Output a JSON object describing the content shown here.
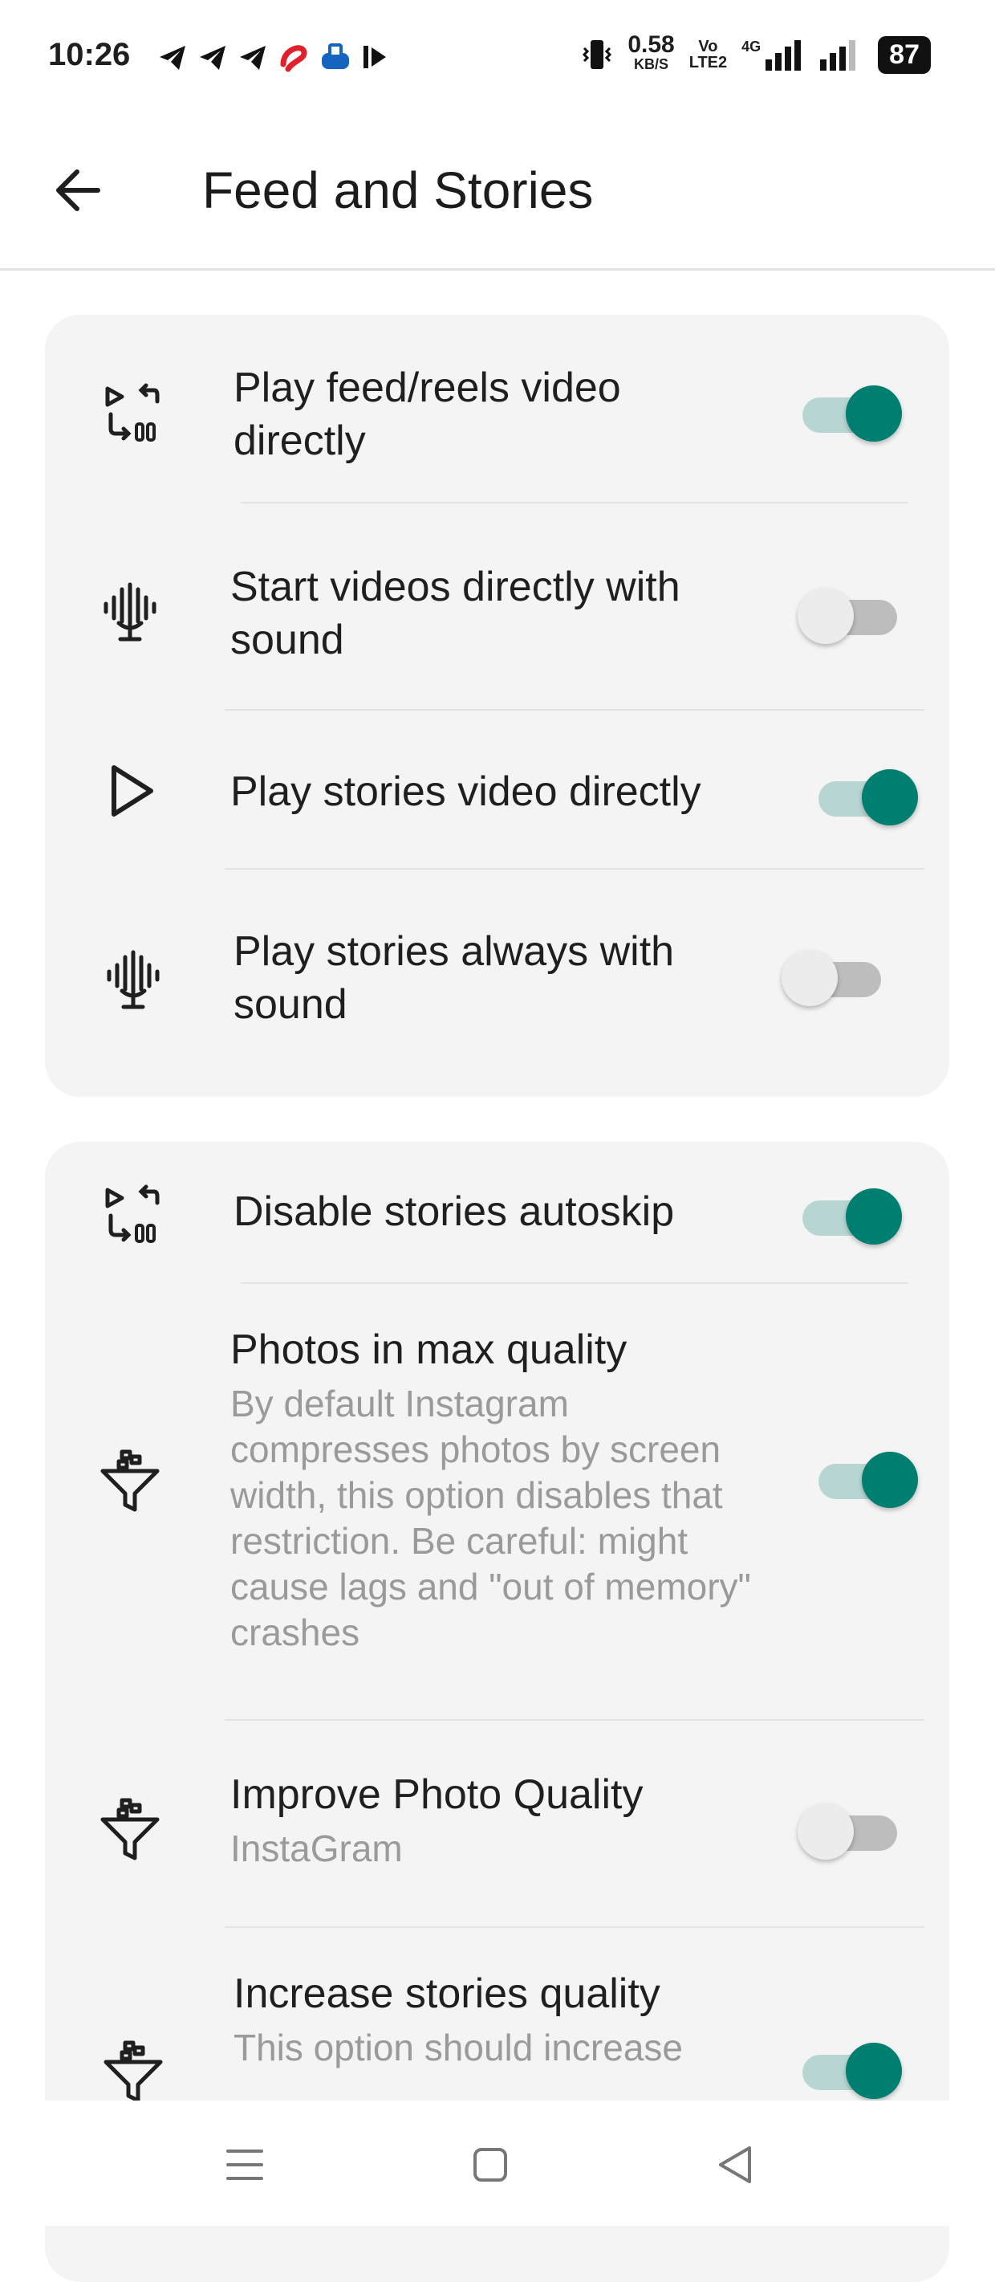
{
  "status_bar": {
    "time": "10:26",
    "net_speed_value": "0.58",
    "net_speed_unit": "KB/S",
    "volte_top": "Vo",
    "volte_bottom": "LTE2",
    "network": "4G",
    "battery": "87"
  },
  "header": {
    "title": "Feed and Stories"
  },
  "sections": [
    {
      "rows": [
        {
          "label_line1": "Play feed/reels video",
          "label_line2": "directly",
          "icon": "swap-icon",
          "enabled": true
        },
        {
          "label_line1": "Start videos directly with",
          "label_line2": "sound",
          "icon": "microphone-icon",
          "enabled": false
        },
        {
          "label_line1": "Play stories video directly",
          "icon": "play-icon",
          "enabled": true
        },
        {
          "label_line1": "Play stories always with",
          "label_line2": "sound",
          "icon": "microphone-icon",
          "enabled": false
        }
      ]
    },
    {
      "rows": [
        {
          "label_line1": "Disable stories autoskip",
          "icon": "swap-icon",
          "enabled": true
        },
        {
          "label_line1": "Photos in max quality",
          "desc_lines": [
            "By default Instagram",
            "compresses photos by screen",
            "width, this option disables that",
            "restriction. Be careful: might",
            "cause lags and \"out of memory\"",
            "crashes"
          ],
          "icon": "filter-icon",
          "enabled": true
        },
        {
          "label_line1": "Improve Photo Quality",
          "desc_lines": [
            "InstaGram"
          ],
          "icon": "filter-icon",
          "enabled": false
        },
        {
          "label_line1": "Increase stories quality",
          "desc_lines": [
            "This option should increase"
          ],
          "icon": "filter-icon",
          "enabled": true
        }
      ]
    }
  ],
  "colors": {
    "accent": "#007f70",
    "accent_track": "#b7d6d3",
    "card_bg": "#f4f4f4",
    "secondary_text": "#9a9a9a"
  }
}
